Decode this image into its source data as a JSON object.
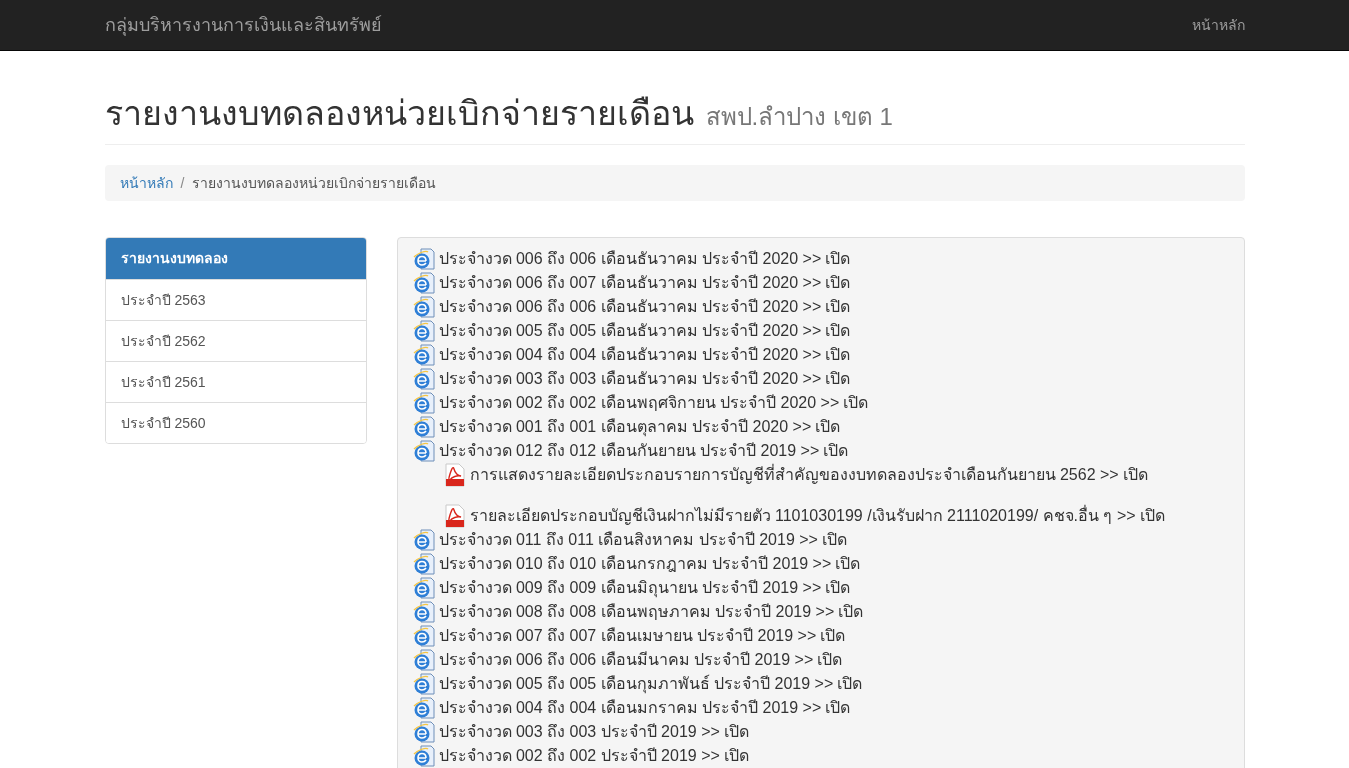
{
  "navbar": {
    "brand": "กลุ่มบริหารงานการเงินและสินทรัพย์",
    "links": [
      "หน้าหลัก"
    ]
  },
  "page_header": {
    "title": "รายงานงบทดลองหน่วยเบิกจ่ายรายเดือน",
    "subtitle": "สพป.ลำปาง เขต 1"
  },
  "breadcrumb": {
    "items": [
      {
        "label": "หน้าหลัก",
        "kind": "link"
      },
      {
        "label": "รายงานงบทดลองหน่วยเบิกจ่ายรายเดือน",
        "kind": "current"
      }
    ],
    "separator": "/"
  },
  "sidebar": {
    "items": [
      {
        "label": "รายงานงบทดลอง",
        "selected": true
      },
      {
        "label": "ประจำปี 2563",
        "selected": false
      },
      {
        "label": "ประจำปี 2562",
        "selected": false
      },
      {
        "label": "ประจำปี 2561",
        "selected": false
      },
      {
        "label": "ประจำปี 2560",
        "selected": false
      }
    ]
  },
  "reports": [
    {
      "kind": "web",
      "text": "ประจำงวด 006 ถึง 006 เดือนธันวาคม ประจำปี 2020 >>",
      "link": "เปิด"
    },
    {
      "kind": "web",
      "text": "ประจำงวด 006 ถึง 007 เดือนธันวาคม ประจำปี 2020 >>",
      "link": "เปิด"
    },
    {
      "kind": "web",
      "text": "ประจำงวด 006 ถึง 006 เดือนธันวาคม ประจำปี 2020 >>",
      "link": "เปิด"
    },
    {
      "kind": "web",
      "text": "ประจำงวด 005 ถึง 005 เดือนธันวาคม ประจำปี 2020 >>",
      "link": "เปิด"
    },
    {
      "kind": "web",
      "text": "ประจำงวด 004 ถึง 004 เดือนธันวาคม ประจำปี 2020 >>",
      "link": "เปิด"
    },
    {
      "kind": "web",
      "text": "ประจำงวด 003 ถึง 003 เดือนธันวาคม ประจำปี 2020 >>",
      "link": "เปิด"
    },
    {
      "kind": "web",
      "text": "ประจำงวด 002 ถึง 002 เดือนพฤศจิกายน ประจำปี 2020 >>",
      "link": "เปิด"
    },
    {
      "kind": "web",
      "text": "ประจำงวด 001 ถึง 001 เดือนตุลาคม ประจำปี 2020 >>",
      "link": "เปิด"
    },
    {
      "kind": "web",
      "text": "ประจำงวด 012 ถึง 012 เดือนกันยายน ประจำปี 2019 >>",
      "link": "เปิด"
    },
    {
      "kind": "pdf",
      "text": "การแสดงรายละเอียดประกอบรายการบัญชีที่สำคัญของงบทดลองประจำเดือนกันยายน 2562 >>",
      "link": "เปิด"
    },
    {
      "kind": "pdf",
      "text": "รายละเอียดประกอบบัญชีเงินฝากไม่มีรายตัว 1101030199 /เงินรับฝาก 2111020199/ คชจ.อื่น ๆ >>",
      "link": "เปิด"
    },
    {
      "kind": "web",
      "text": "ประจำงวด 011 ถึง 011 เดือนสิงหาคม ประจำปี 2019 >>",
      "link": "เปิด"
    },
    {
      "kind": "web",
      "text": "ประจำงวด 010 ถึง 010 เดือนกรกฎาคม ประจำปี 2019 >>",
      "link": "เปิด"
    },
    {
      "kind": "web",
      "text": "ประจำงวด 009 ถึง 009 เดือนมิถุนายน ประจำปี 2019 >>",
      "link": "เปิด"
    },
    {
      "kind": "web",
      "text": "ประจำงวด 008 ถึง 008 เดือนพฤษภาคม ประจำปี 2019 >>",
      "link": "เปิด"
    },
    {
      "kind": "web",
      "text": "ประจำงวด 007 ถึง 007 เดือนเมษายน ประจำปี 2019 >>",
      "link": "เปิด"
    },
    {
      "kind": "web",
      "text": "ประจำงวด 006 ถึง 006 เดือนมีนาคม ประจำปี 2019 >>",
      "link": "เปิด"
    },
    {
      "kind": "web",
      "text": "ประจำงวด 005 ถึง 005 เดือนกุมภาพันธ์ ประจำปี 2019 >>",
      "link": "เปิด"
    },
    {
      "kind": "web",
      "text": "ประจำงวด 004 ถึง 004 เดือนมกราคม ประจำปี 2019 >>",
      "link": "เปิด"
    },
    {
      "kind": "web",
      "text": "ประจำงวด 003 ถึง 003 ประจำปี 2019 >>",
      "link": "เปิด"
    },
    {
      "kind": "web",
      "text": "ประจำงวด 002 ถึง 002 ประจำปี 2019 >>",
      "link": "เปิด"
    }
  ]
}
